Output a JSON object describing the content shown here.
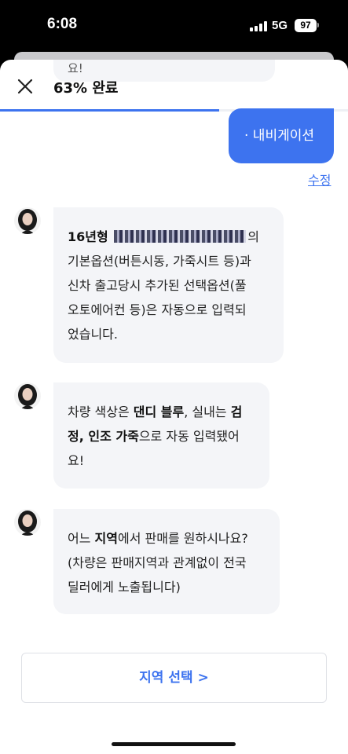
{
  "status_bar": {
    "time": "6:08",
    "network": "5G",
    "battery": "97"
  },
  "peek": {
    "text": "요!"
  },
  "header": {
    "progress_label": "63% 완료",
    "progress_fraction": 0.63
  },
  "user_message": {
    "text": "· 내비게이션",
    "edit_label": "수정"
  },
  "messages": [
    {
      "parts": [
        {
          "text": "16년형 ",
          "bold": true
        },
        {
          "text": "",
          "redacted": true
        },
        {
          "text": "의\n기본옵션(버튼시동, 가죽시트 등)과\n신차 출고당시 추가된 선택옵션(풀\n오토에어컨 등)은 자동으로 입력되\n었습니다."
        }
      ]
    },
    {
      "parts": [
        {
          "text": "차량 색상은 "
        },
        {
          "text": "댄디 블루",
          "bold": true
        },
        {
          "text": ", 실내는 "
        },
        {
          "text": "검\n정, 인조 가죽",
          "bold": true
        },
        {
          "text": "으로 자동 입력됐어\n요!"
        }
      ]
    },
    {
      "parts": [
        {
          "text": "어느 "
        },
        {
          "text": "지역",
          "bold": true
        },
        {
          "text": "에서 판매를 원하시나요?\n(차량은 판매지역과 관계없이 전국\n딜러에게 노출됩니다)"
        }
      ]
    }
  ],
  "region_button": {
    "label": "지역 선택  >"
  }
}
